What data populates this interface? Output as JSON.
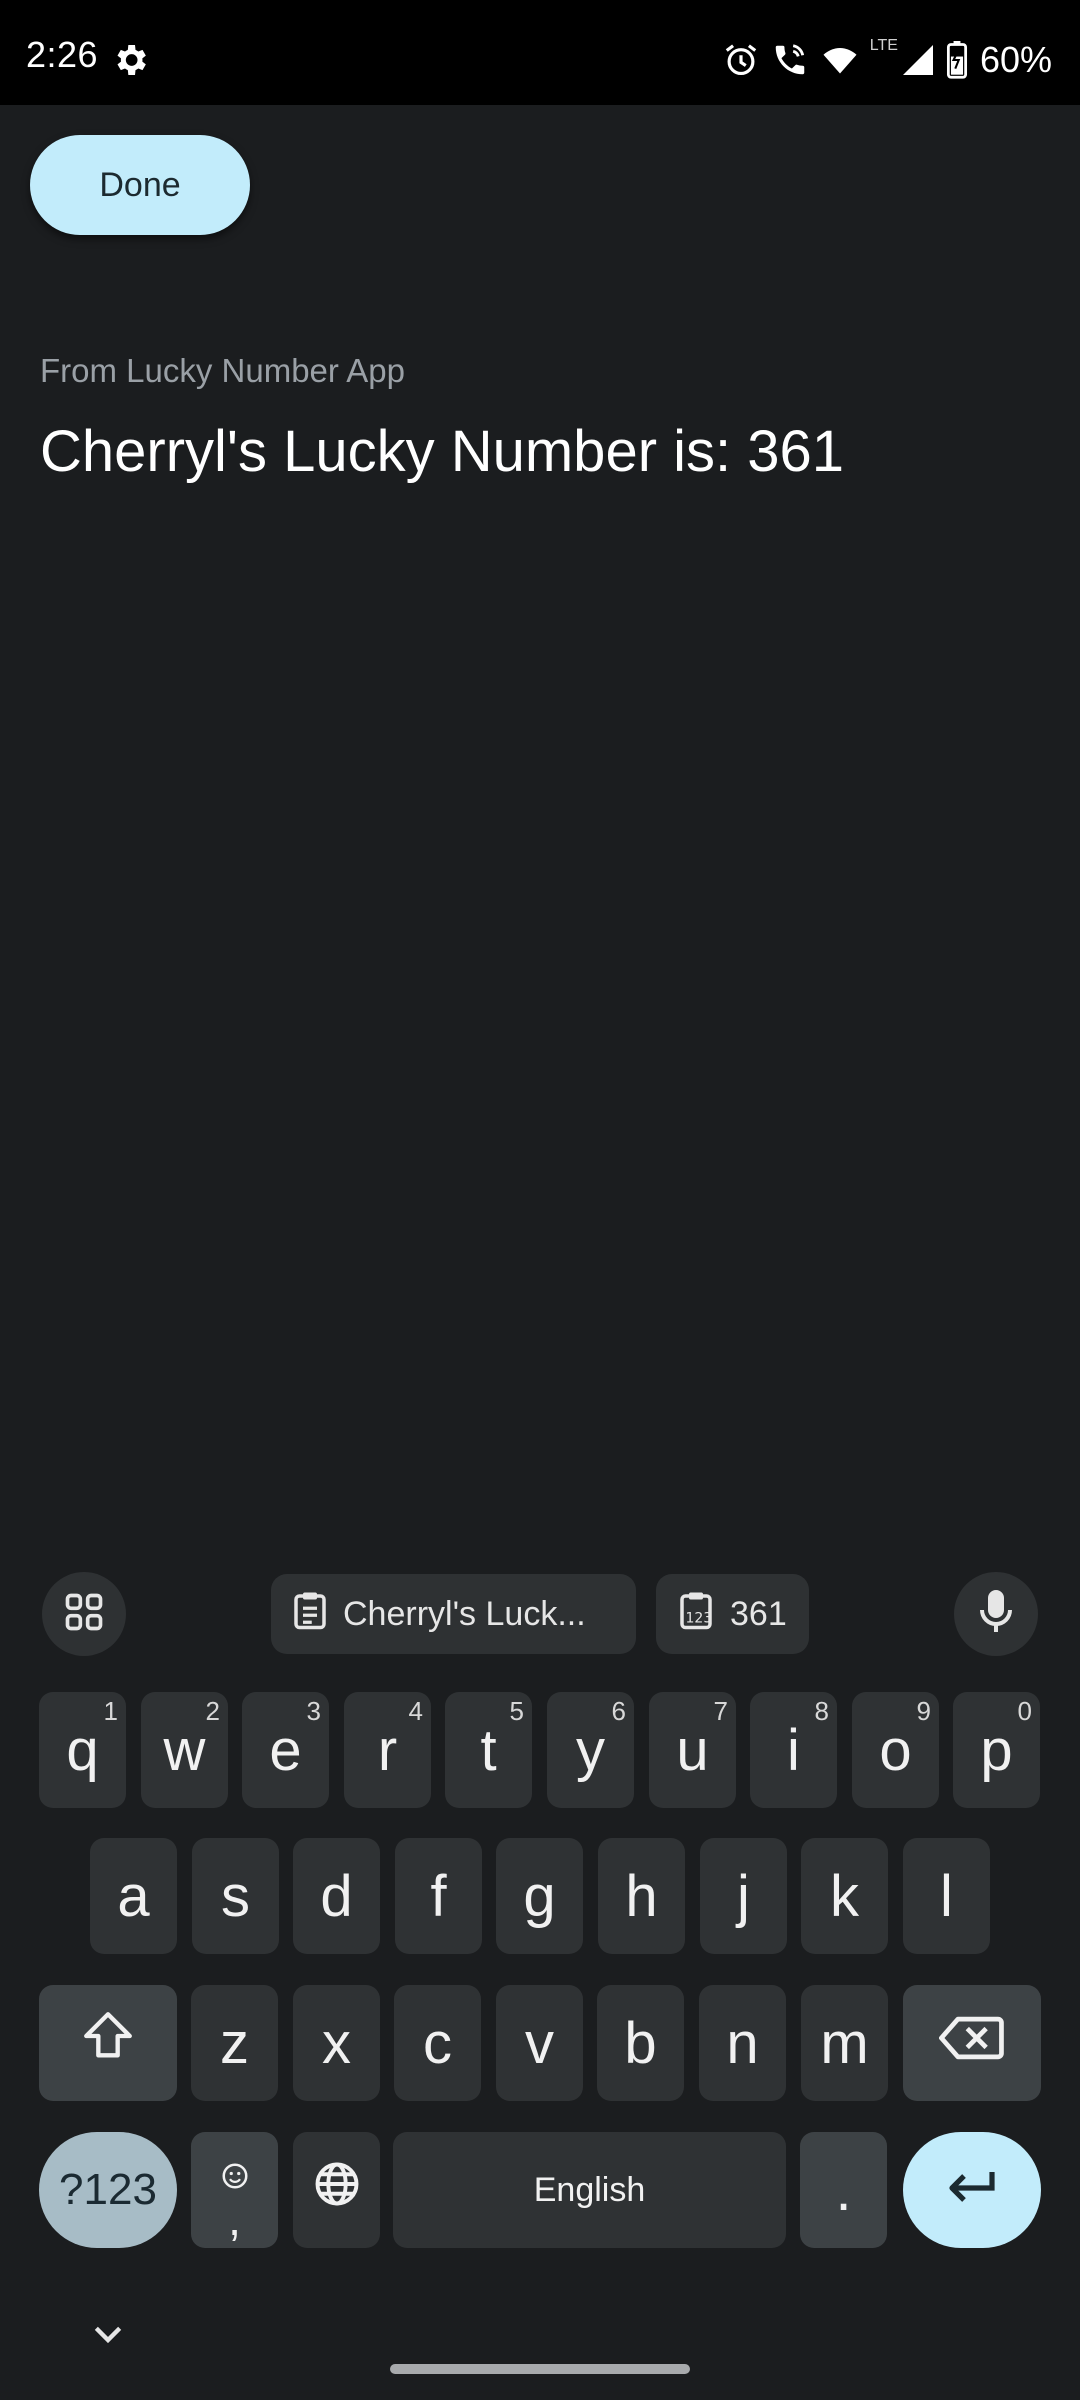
{
  "status_bar": {
    "time": "2:26",
    "lte": "LTE",
    "battery": "60%"
  },
  "top": {
    "done_label": "Done"
  },
  "content": {
    "source_label": "From Lucky Number App",
    "share_text": "Cherryl's Lucky Number is: 361"
  },
  "keyboard": {
    "suggestions": [
      "Cherryl's Luck...",
      "361"
    ],
    "row1": [
      {
        "key": "q",
        "hint": "1"
      },
      {
        "key": "w",
        "hint": "2"
      },
      {
        "key": "e",
        "hint": "3"
      },
      {
        "key": "r",
        "hint": "4"
      },
      {
        "key": "t",
        "hint": "5"
      },
      {
        "key": "y",
        "hint": "6"
      },
      {
        "key": "u",
        "hint": "7"
      },
      {
        "key": "i",
        "hint": "8"
      },
      {
        "key": "o",
        "hint": "9"
      },
      {
        "key": "p",
        "hint": "0"
      }
    ],
    "row2": [
      "a",
      "s",
      "d",
      "f",
      "g",
      "h",
      "j",
      "k",
      "l"
    ],
    "row3": [
      "z",
      "x",
      "c",
      "v",
      "b",
      "n",
      "m"
    ],
    "symbols_label": "?123",
    "comma_label": ",",
    "space_label": "English",
    "period_label": ".",
    "icons": [
      "apps-grid-icon",
      "clipboard-icon",
      "clipboard-numbers-icon",
      "mic-icon",
      "shift-icon",
      "backspace-icon",
      "emoji-icon",
      "globe-icon",
      "enter-icon",
      "chevron-down-icon"
    ]
  },
  "colors": {
    "background": "#1b1d1f",
    "accent": "#c2ecfb",
    "key": "#2f3234",
    "key_dark": "#3d4245",
    "symbols_key": "#a7bcc6"
  }
}
